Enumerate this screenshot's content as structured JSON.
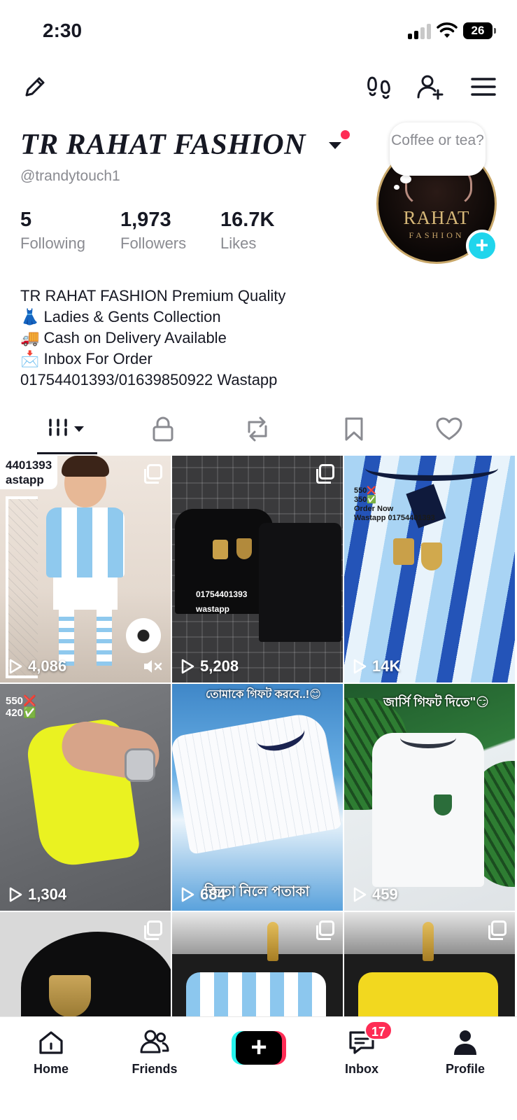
{
  "status_bar": {
    "time": "2:30",
    "battery": "26"
  },
  "profile": {
    "display_name": "TR RAHAT FASHION",
    "username": "@trandytouch1",
    "stats": [
      {
        "value": "5",
        "label": "Following"
      },
      {
        "value": "1,973",
        "label": "Followers"
      },
      {
        "value": "16.7K",
        "label": "Likes"
      }
    ],
    "avatar_bubble": "Coffee or tea?",
    "avatar_logo": {
      "title": "RAHAT",
      "subtitle": "FASHION"
    },
    "bio_lines": [
      "TR RAHAT FASHION Premium Quality",
      "👗 Ladies & Gents Collection",
      "🚚 Cash on Delivery Available",
      "📩 Inbox For Order",
      "01754401393/01639850922 Wastapp"
    ]
  },
  "tabs": [
    "videos-tab",
    "private-tab",
    "reposts-tab",
    "favorites-tab",
    "liked-tab"
  ],
  "grid": [
    {
      "views": "4,086",
      "overlay": "4401393\nastapp"
    },
    {
      "views": "5,208",
      "overlay": "01754401393\nwastapp"
    },
    {
      "views": "14K",
      "overlay": "550❌\n350✅\nOrder Now\nWastapp 01754401393"
    },
    {
      "views": "1,304",
      "overlay": "550❌\n420✅"
    },
    {
      "views": "684",
      "overlay_top": "তোমাকে গিফট করবে..!😊",
      "overlay_bottom": "জিতা নিলে পতাকা"
    },
    {
      "views": "459",
      "overlay_top": "জার্সি গিফট দিতে\"😏"
    },
    {
      "views": ""
    },
    {
      "views": ""
    },
    {
      "views": ""
    }
  ],
  "bottom_nav": {
    "home": "Home",
    "friends": "Friends",
    "inbox": "Inbox",
    "inbox_badge": "17",
    "profile": "Profile"
  },
  "colors": {
    "accent": "#fe2c55",
    "cyan": "#25f4ee",
    "avatar_plus": "#20d5ec"
  }
}
